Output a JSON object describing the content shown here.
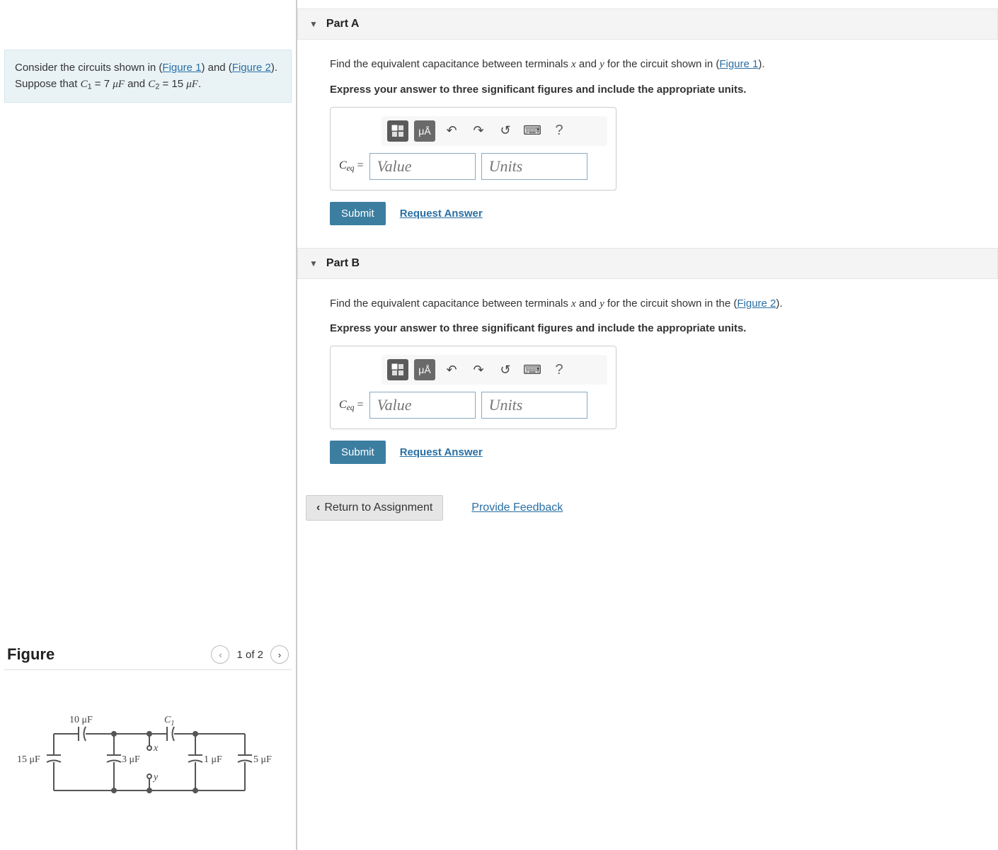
{
  "problem": {
    "intro_prefix": "Consider the circuits shown in (",
    "fig1_link": "Figure 1",
    "intro_mid": ") and (",
    "fig2_link": "Figure 2",
    "intro_suffix": ").",
    "suppose": "Suppose that ",
    "c1_sym": "C",
    "c1_sub": "1",
    "c1_eq": " = 7 ",
    "muF": "μF",
    "and_word": " and ",
    "c2_sym": "C",
    "c2_sub": "2",
    "c2_eq": " = 15 ",
    "period": "."
  },
  "figure": {
    "title": "Figure",
    "counter": "1 of 2",
    "labels": {
      "c10": "10 μF",
      "c1": "C",
      "c1sub": "1",
      "c15": "15 μF",
      "c3": "3 μF",
      "c1mu": "1 μF",
      "c5": "5 μF",
      "x": "x",
      "y": "y"
    }
  },
  "parts": {
    "a": {
      "header": "Part A",
      "prompt_pre": "Find the equivalent capacitance between terminals ",
      "x": "x",
      "and": " and ",
      "y": "y",
      "prompt_mid": " for the circuit shown in (",
      "fig_link": "Figure 1",
      "prompt_post": ").",
      "instruction": "Express your answer to three significant figures and include the appropriate units.",
      "ceq_C": "C",
      "ceq_sub": "eq",
      "ceq_eq": " = ",
      "value_ph": "Value",
      "units_ph": "Units",
      "submit": "Submit",
      "request": "Request Answer"
    },
    "b": {
      "header": "Part B",
      "prompt_pre": "Find the equivalent capacitance between terminals ",
      "x": "x",
      "and": " and ",
      "y": "y",
      "prompt_mid": " for the circuit shown in the (",
      "fig_link": "Figure 2",
      "prompt_post": ").",
      "instruction": "Express your answer to three significant figures and include the appropriate units.",
      "ceq_C": "C",
      "ceq_sub": "eq",
      "ceq_eq": " = ",
      "value_ph": "Value",
      "units_ph": "Units",
      "submit": "Submit",
      "request": "Request Answer"
    }
  },
  "toolbar": {
    "mu_a": "μÅ",
    "help": "?"
  },
  "footer": {
    "return": "Return to Assignment",
    "feedback": "Provide Feedback"
  }
}
